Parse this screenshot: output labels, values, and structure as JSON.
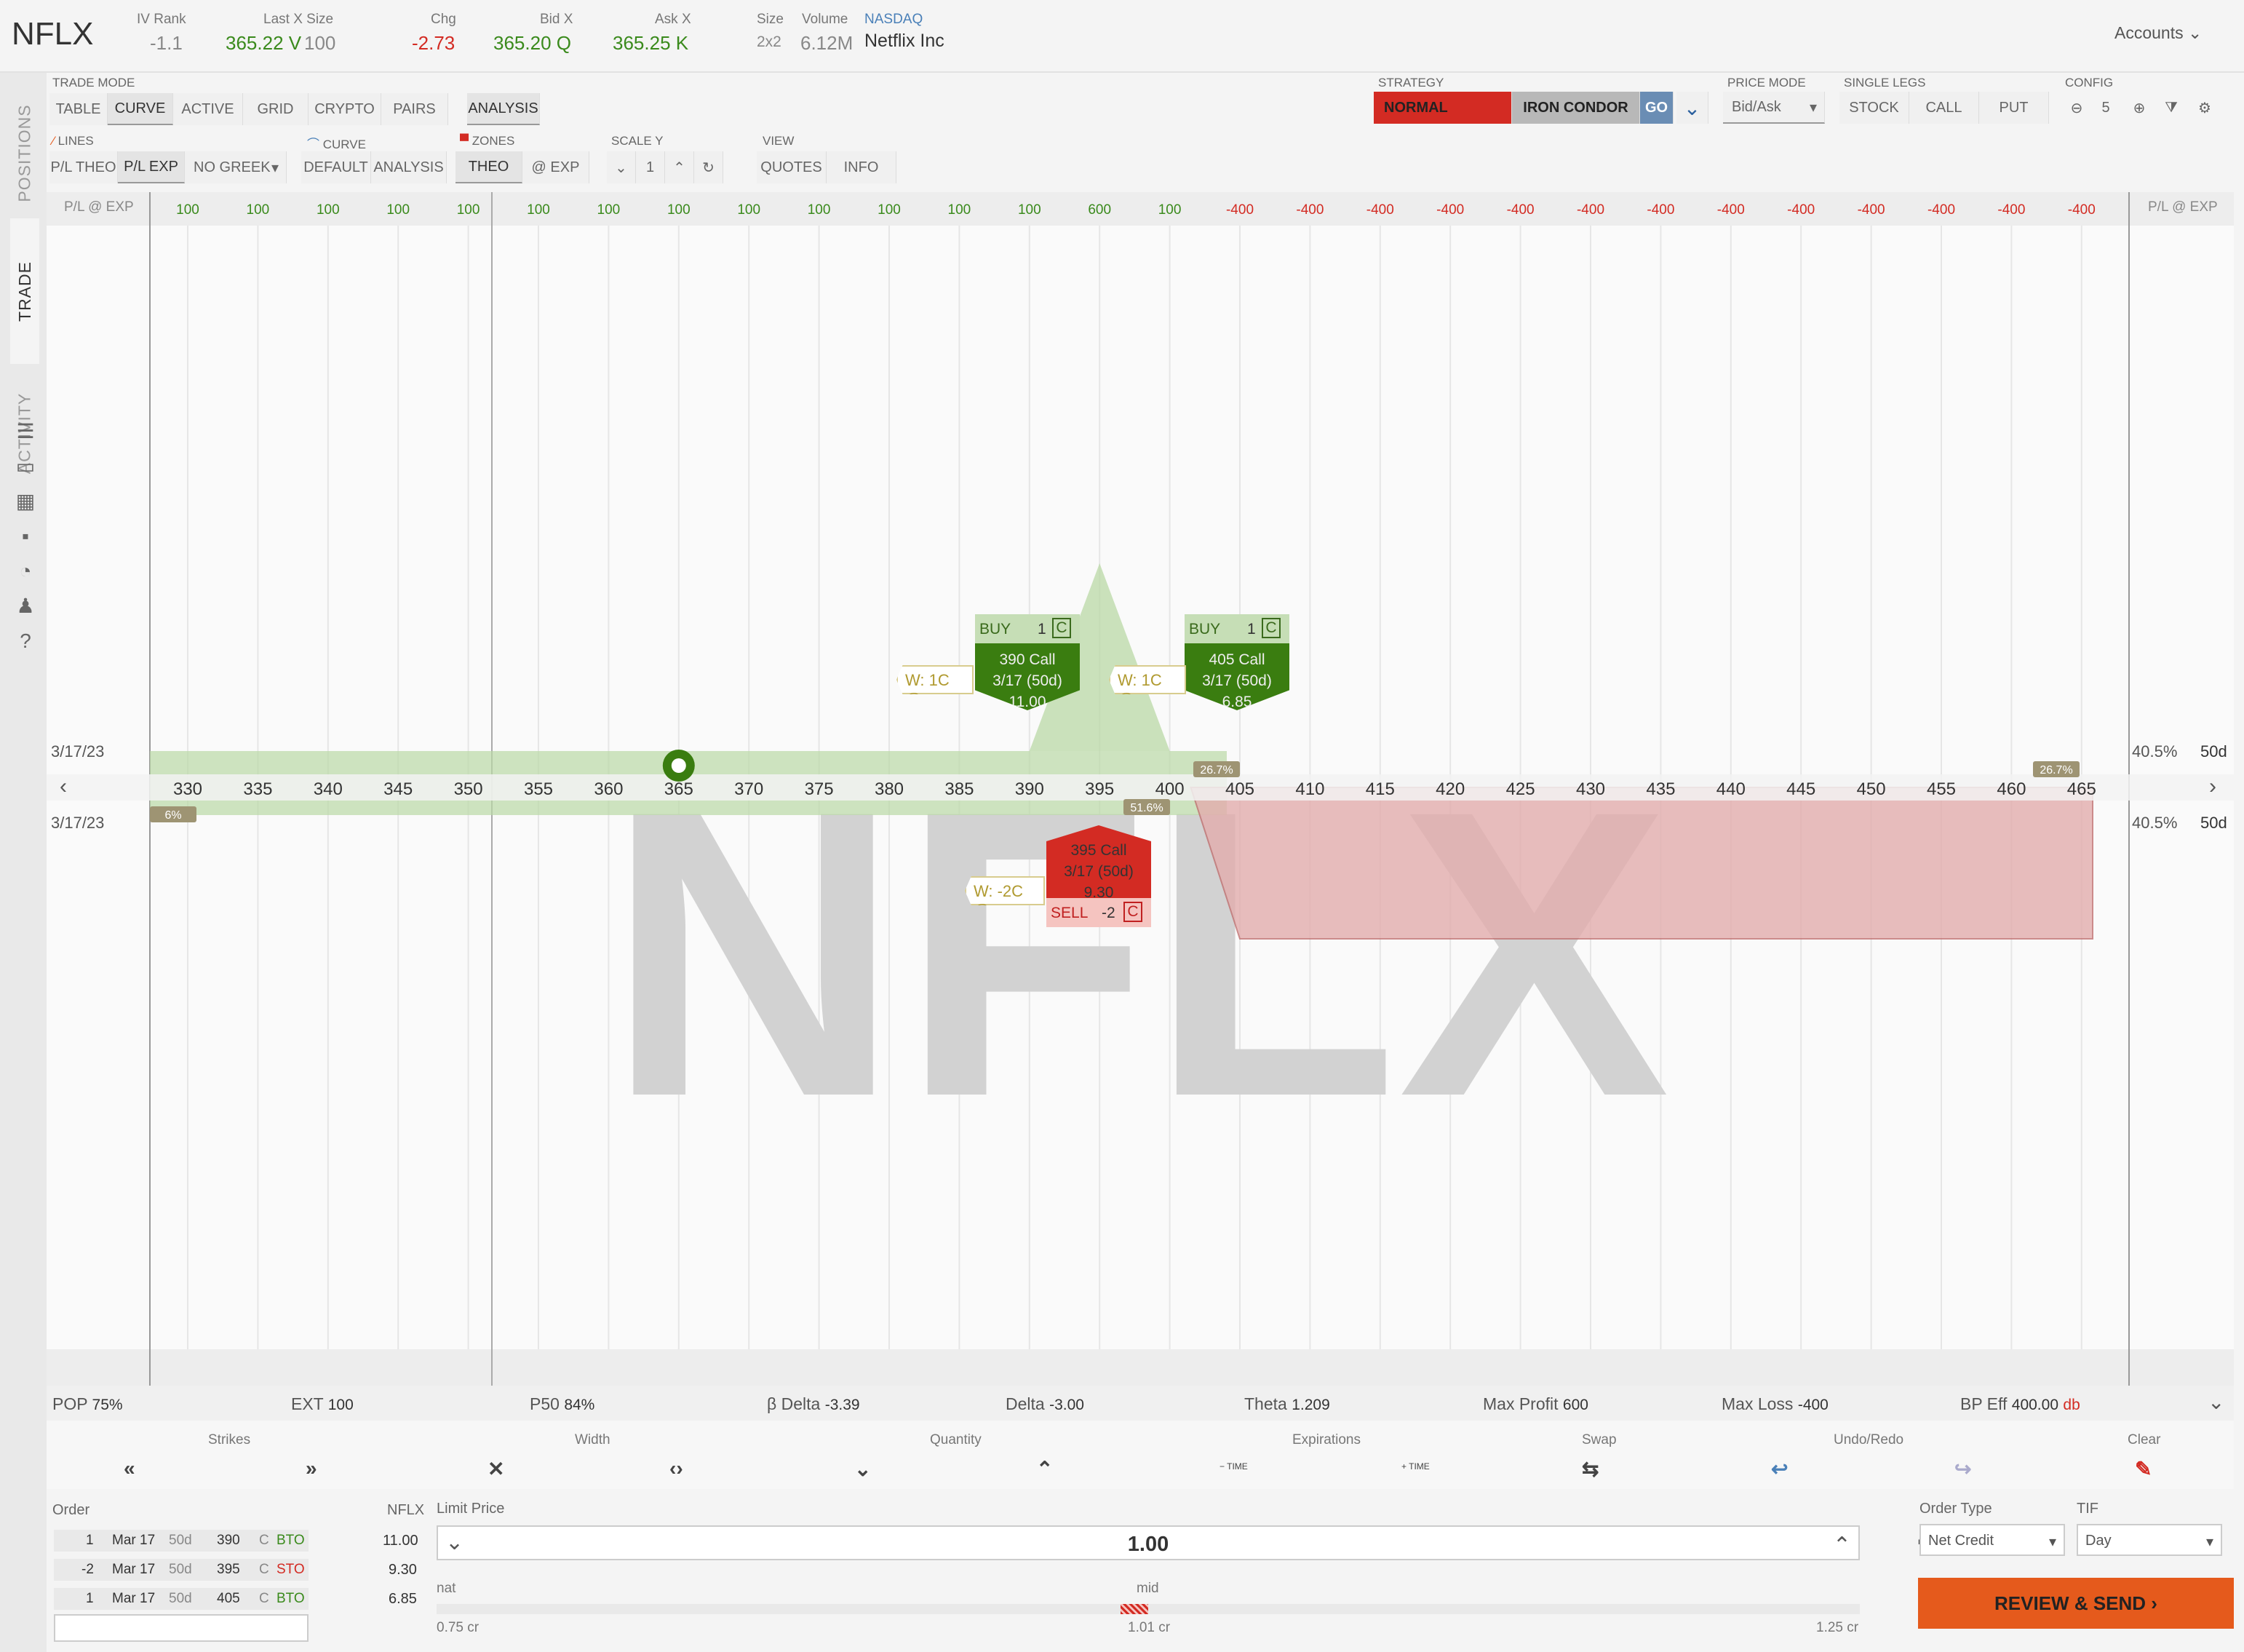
{
  "quote": {
    "symbol": "NFLX",
    "iv_rank_label": "IV Rank",
    "iv_rank": "-1.1",
    "last_size_label": "Last X Size",
    "last_price": "365.22 V",
    "last_size": "100",
    "chg_label": "Chg",
    "chg": "-2.73",
    "bid_label": "Bid X",
    "bid": "365.20 Q",
    "ask_label": "Ask X",
    "ask": "365.25 K",
    "size_label": "Size",
    "size": "2x2",
    "volume_label": "Volume",
    "volume": "6.12M",
    "exchange": "NASDAQ",
    "company": "Netflix Inc",
    "accounts": "Accounts"
  },
  "side_tabs": {
    "positions": "POSITIONS",
    "trade": "TRADE",
    "activity": "ACTIVITY"
  },
  "side_icons": [
    "list-icon",
    "monitor-icon",
    "chart-icon",
    "grid-icon",
    "gauge-icon",
    "people-icon",
    "help-icon"
  ],
  "trade_mode": {
    "label": "TRADE MODE",
    "tabs": [
      "TABLE",
      "CURVE",
      "ACTIVE",
      "GRID",
      "CRYPTO",
      "PAIRS",
      "ANALYSIS"
    ]
  },
  "strategy": {
    "label": "STRATEGY",
    "normal": "NORMAL",
    "iron_condor": "IRON CONDOR",
    "go": "GO"
  },
  "price_mode": {
    "label": "PRICE MODE",
    "value": "Bid/Ask"
  },
  "single_legs": {
    "label": "SINGLE LEGS",
    "stock": "STOCK",
    "call": "CALL",
    "put": "PUT"
  },
  "config": {
    "label": "CONFIG",
    "zoom": "5"
  },
  "lines": {
    "label": "LINES",
    "pl_theo": "P/L THEO",
    "pl_exp": "P/L EXP",
    "greek": "NO GREEK"
  },
  "curve": {
    "label": "CURVE",
    "default": "DEFAULT",
    "analysis": "ANALYSIS"
  },
  "zones": {
    "label": "ZONES",
    "theo": "THEO",
    "at_exp": "@ EXP"
  },
  "scale_y": {
    "label": "SCALE Y",
    "value": "1"
  },
  "view": {
    "label": "VIEW",
    "quotes": "QUOTES",
    "info": "INFO"
  },
  "chart": {
    "pl_label": "P/L @ EXP",
    "pl_values": [
      "100",
      "100",
      "100",
      "100",
      "100",
      "100",
      "100",
      "100",
      "100",
      "100",
      "100",
      "100",
      "100",
      "600",
      "100",
      "-400",
      "-400",
      "-400",
      "-400",
      "-400",
      "-400",
      "-400",
      "-400",
      "-400",
      "-400",
      "-400",
      "-400",
      "-400"
    ],
    "strikes": [
      "330",
      "335",
      "340",
      "345",
      "350",
      "355",
      "360",
      "365",
      "370",
      "375",
      "380",
      "385",
      "390",
      "395",
      "400",
      "405",
      "410",
      "415",
      "420",
      "425",
      "430",
      "435",
      "440",
      "445",
      "450",
      "455",
      "460",
      "465"
    ],
    "date_top": "3/17/23",
    "date_bottom": "3/17/23",
    "iv_top": "40.5%",
    "days_top": "50d",
    "iv_bottom": "40.5%",
    "days_bottom": "50d",
    "watermark": "NFLX",
    "prob_left": "6%",
    "prob_mid": "51.6%",
    "prob_right1": "26.7%",
    "prob_right2": "26.7%"
  },
  "legs": [
    {
      "action": "BUY",
      "qty": "1",
      "type": "C",
      "desc": "390 Call",
      "exp": "3/17 (50d)",
      "price": "11.00",
      "what_if": "W: 1C @"
    },
    {
      "action": "BUY",
      "qty": "1",
      "type": "C",
      "desc": "405 Call",
      "exp": "3/17 (50d)",
      "price": "6.85",
      "what_if": "W: 1C @"
    },
    {
      "action": "SELL",
      "qty": "-2",
      "type": "C",
      "desc": "395 Call",
      "exp": "3/17 (50d)",
      "price": "9.30",
      "what_if": "W: -2C @"
    }
  ],
  "stats": {
    "pop_l": "POP",
    "pop": "75%",
    "ext_l": "EXT",
    "ext": "100",
    "p50_l": "P50",
    "p50": "84%",
    "bdelta_l": "β Delta",
    "bdelta": "-3.39",
    "delta_l": "Delta",
    "delta": "-3.00",
    "theta_l": "Theta",
    "theta": "1.209",
    "maxp_l": "Max Profit",
    "maxp": "600",
    "maxl_l": "Max Loss",
    "maxl": "-400",
    "bp_l": "BP Eff",
    "bp": "400.00",
    "bp_unit": "db"
  },
  "tools": {
    "strikes": "Strikes",
    "width": "Width",
    "quantity": "Quantity",
    "expirations": "Expirations",
    "swap": "Swap",
    "undo": "Undo/Redo",
    "clear": "Clear",
    "time": "TIME"
  },
  "order": {
    "label": "Order",
    "sym": "NFLX",
    "rows": [
      {
        "qty": "1",
        "date": "Mar 17",
        "days": "50d",
        "strike": "390",
        "type": "C",
        "side": "BTO",
        "price": "11.00"
      },
      {
        "qty": "-2",
        "date": "Mar 17",
        "days": "50d",
        "strike": "395",
        "type": "C",
        "side": "STO",
        "price": "9.30"
      },
      {
        "qty": "1",
        "date": "Mar 17",
        "days": "50d",
        "strike": "405",
        "type": "C",
        "side": "BTO",
        "price": "6.85"
      }
    ],
    "limit_label": "Limit Price",
    "limit": "1.00",
    "nat": "nat",
    "mid": "mid",
    "low": "0.75 cr",
    "center": "1.01 cr",
    "high": "1.25 cr",
    "order_type_label": "Order Type",
    "order_type": "Net Credit",
    "tif_label": "TIF",
    "tif": "Day",
    "review": "REVIEW & SEND"
  }
}
